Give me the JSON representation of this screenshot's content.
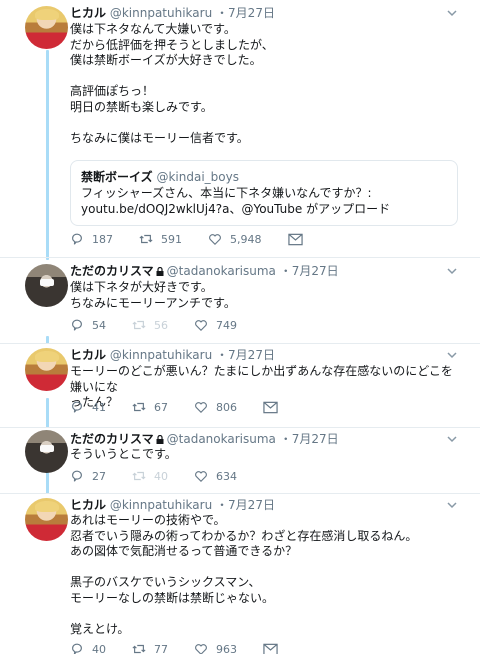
{
  "tweets": [
    {
      "name": "ヒカル",
      "handle": "@kinnpatuhikaru",
      "date": "7月27日",
      "lines": [
        "僕は下ネタなんて大嫌いです。",
        "だから低評価を押そうとしましたが、",
        "僕は禁断ボーイズが大好きでした。",
        "",
        "高評価ぽちっ！",
        "明日の禁断も楽しみです。",
        "",
        "ちなみに僕はモーリー信者です。"
      ],
      "quote": {
        "name": "禁断ボーイズ",
        "handle": "@kindai_boys",
        "text": "フィッシャーズさん、本当に下ネタ嫌いなんですか？: youtu.be/dOQJ2wklUj4?a、@YouTube がアップロード"
      },
      "replies": "187",
      "retweets": "591",
      "likes": "5,948",
      "retweets_dim": false
    },
    {
      "name": "ただのカリスマ",
      "handle": "@tadanokarisuma",
      "date": "7月27日",
      "lines": [
        "僕は下ネタが大好きです。",
        "ちなみにモーリーアンチです。"
      ],
      "replies": "54",
      "retweets": "56",
      "likes": "749",
      "retweets_dim": true
    },
    {
      "name": "ヒカル",
      "handle": "@kinnpatuhikaru",
      "date": "7月27日",
      "lines": [
        "モーリーのどこが悪いん？たまにしか出ずあんな存在感ないのにどこを嫌いにな",
        "ったん？"
      ],
      "replies": "41",
      "retweets": "67",
      "likes": "806",
      "retweets_dim": false
    },
    {
      "name": "ただのカリスマ",
      "handle": "@tadanokarisuma",
      "date": "7月27日",
      "lines": [
        "そういうとこです。"
      ],
      "replies": "27",
      "retweets": "40",
      "likes": "634",
      "retweets_dim": true
    },
    {
      "name": "ヒカル",
      "handle": "@kinnpatuhikaru",
      "date": "7月27日",
      "lines": [
        "あれはモーリーの技術やで。",
        "忍者でいう隠みの術ってわかるか？わざと存在感消し取るねん。",
        "あの図体で気配消せるって普通できるか？",
        "",
        "黒子のバスケでいうシックスマン、",
        "モーリーなしの禁断は禁断じゃない。",
        "",
        "覚えとけ。"
      ],
      "replies": "40",
      "retweets": "77",
      "likes": "963",
      "retweets_dim": false
    }
  ],
  "separator": "・"
}
